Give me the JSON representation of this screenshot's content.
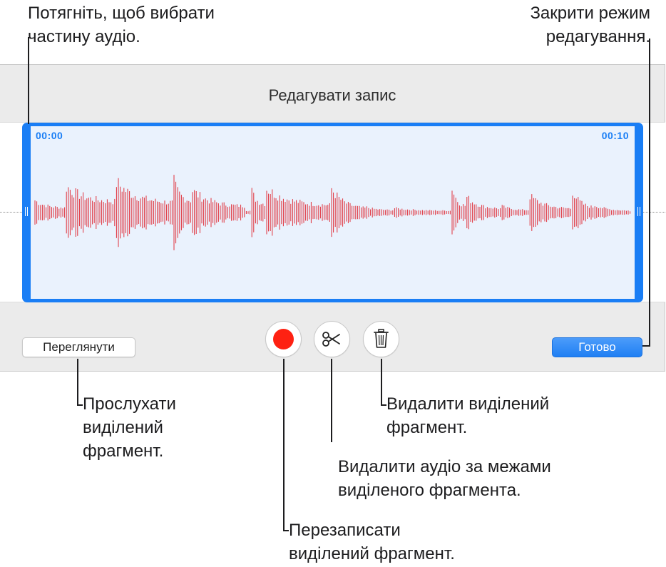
{
  "callouts": {
    "drag_select": "Потягніть, щоб вибрати\nчастину аудіо.",
    "close_edit": "Закрити режим\nредагування.",
    "play_selection": "Прослухати\nвиділений\nфрагмент.",
    "delete_selection": "Видалити виділений\nфрагмент.",
    "trim_outside": "Видалити аудіо за межами\nвиділеного фрагмента.",
    "rerecord": "Перезаписати\nвиділений фрагмент."
  },
  "editor": {
    "title": "Редагувати запис",
    "start_time": "00:00",
    "end_time": "00:10",
    "review_label": "Переглянути",
    "done_label": "Готово"
  },
  "icons": {
    "record": "record-icon",
    "trim": "scissors-icon",
    "delete": "trash-icon"
  },
  "colors": {
    "accent": "#1a7ef5",
    "waveform": "#e0303a",
    "record": "#fe2112",
    "selection_fill": "#eaf2fd"
  }
}
